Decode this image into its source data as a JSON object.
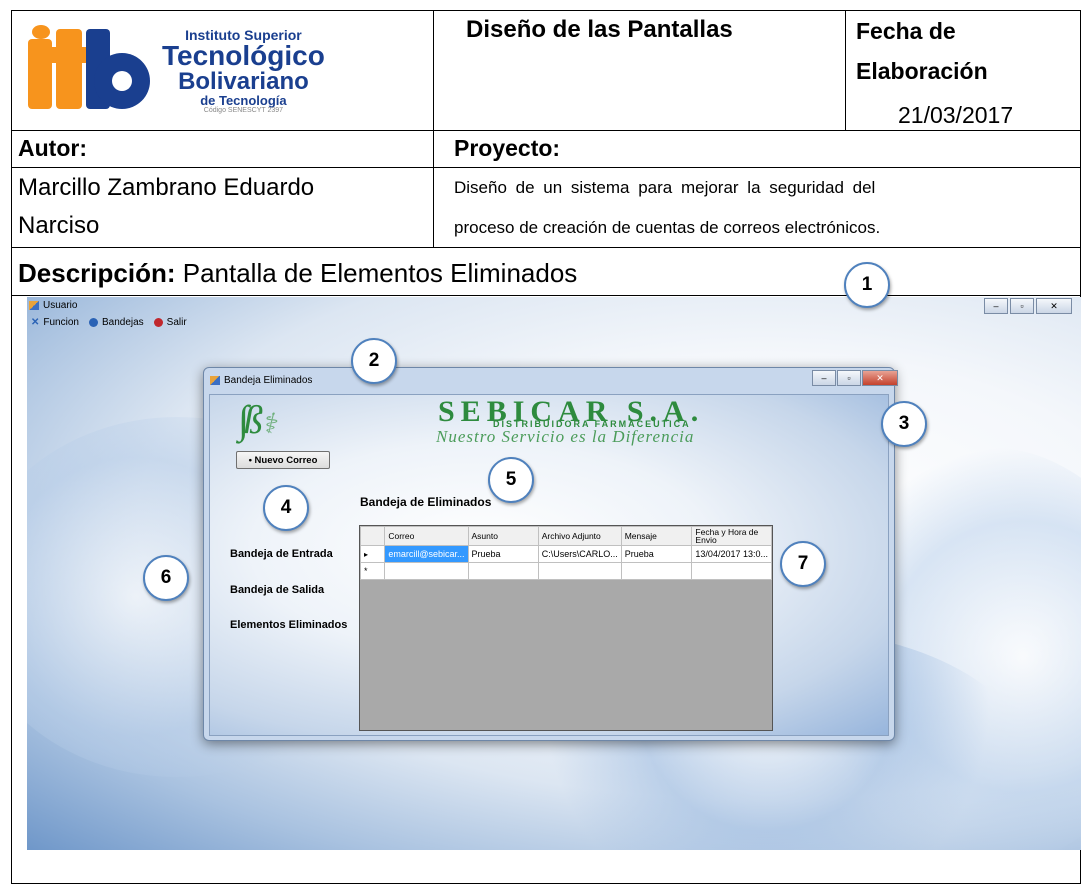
{
  "header": {
    "logo": {
      "mark": "itb",
      "line1": "Instituto Superior",
      "line2": "Tecnológico",
      "line3": "Bolivariano",
      "line4": "de Tecnología",
      "line5": "Código SENESCYT 2397"
    },
    "title": "Diseño de las Pantallas",
    "fecha_label_1": "Fecha de",
    "fecha_label_2": "Elaboración",
    "fecha_value": "21/03/2017",
    "autor_label": "Autor:",
    "proyecto_label": "Proyecto:",
    "autor_value_1": "Marcillo Zambrano Eduardo",
    "autor_value_2": "Narciso",
    "proyecto_value_1": "Diseño de un sistema para mejorar la seguridad del",
    "proyecto_value_2": "proceso de creación de cuentas de correos electrónicos.",
    "descripcion_label": "Descripción:",
    "descripcion_value": "Pantalla de Elementos Eliminados"
  },
  "app": {
    "title": "Usuario",
    "menu": [
      {
        "label": "Funcion",
        "icon": "function-icon"
      },
      {
        "label": "Bandejas",
        "icon": "bandejas-icon"
      },
      {
        "label": "Salir",
        "icon": "exit-icon"
      }
    ]
  },
  "dialog": {
    "title": "Bandeja Eliminados",
    "banner_big": "SEBICAR S.A.",
    "banner_sub": "DISTRIBUIDORA FARMACEUTICA",
    "banner_slogan": "Nuestro Servicio es la Diferencia",
    "new_mail_button": "• Nuevo Correo",
    "section_title": "Bandeja de Eliminados",
    "sidebar": [
      "Bandeja de Entrada",
      "Bandeja de Salida",
      "Elementos Eliminados"
    ],
    "grid": {
      "columns": [
        "Correo",
        "Asunto",
        "Archivo Adjunto",
        "Mensaje",
        "Fecha y Hora de Envio"
      ],
      "rows": [
        [
          "emarcill@sebicar...",
          "Prueba",
          "C:\\Users\\CARLO...",
          "Prueba",
          "13/04/2017 13:0..."
        ]
      ],
      "row_marker": "▸",
      "new_row_marker": "*"
    }
  },
  "callouts": [
    "1",
    "2",
    "3",
    "4",
    "5",
    "6",
    "7"
  ],
  "colors": {
    "itb_orange": "#f7941d",
    "itb_blue": "#1a3f8f",
    "sebicar_green": "#2e8b3e",
    "callout_border": "#4f81bd",
    "selected_cell": "#3399ff"
  }
}
